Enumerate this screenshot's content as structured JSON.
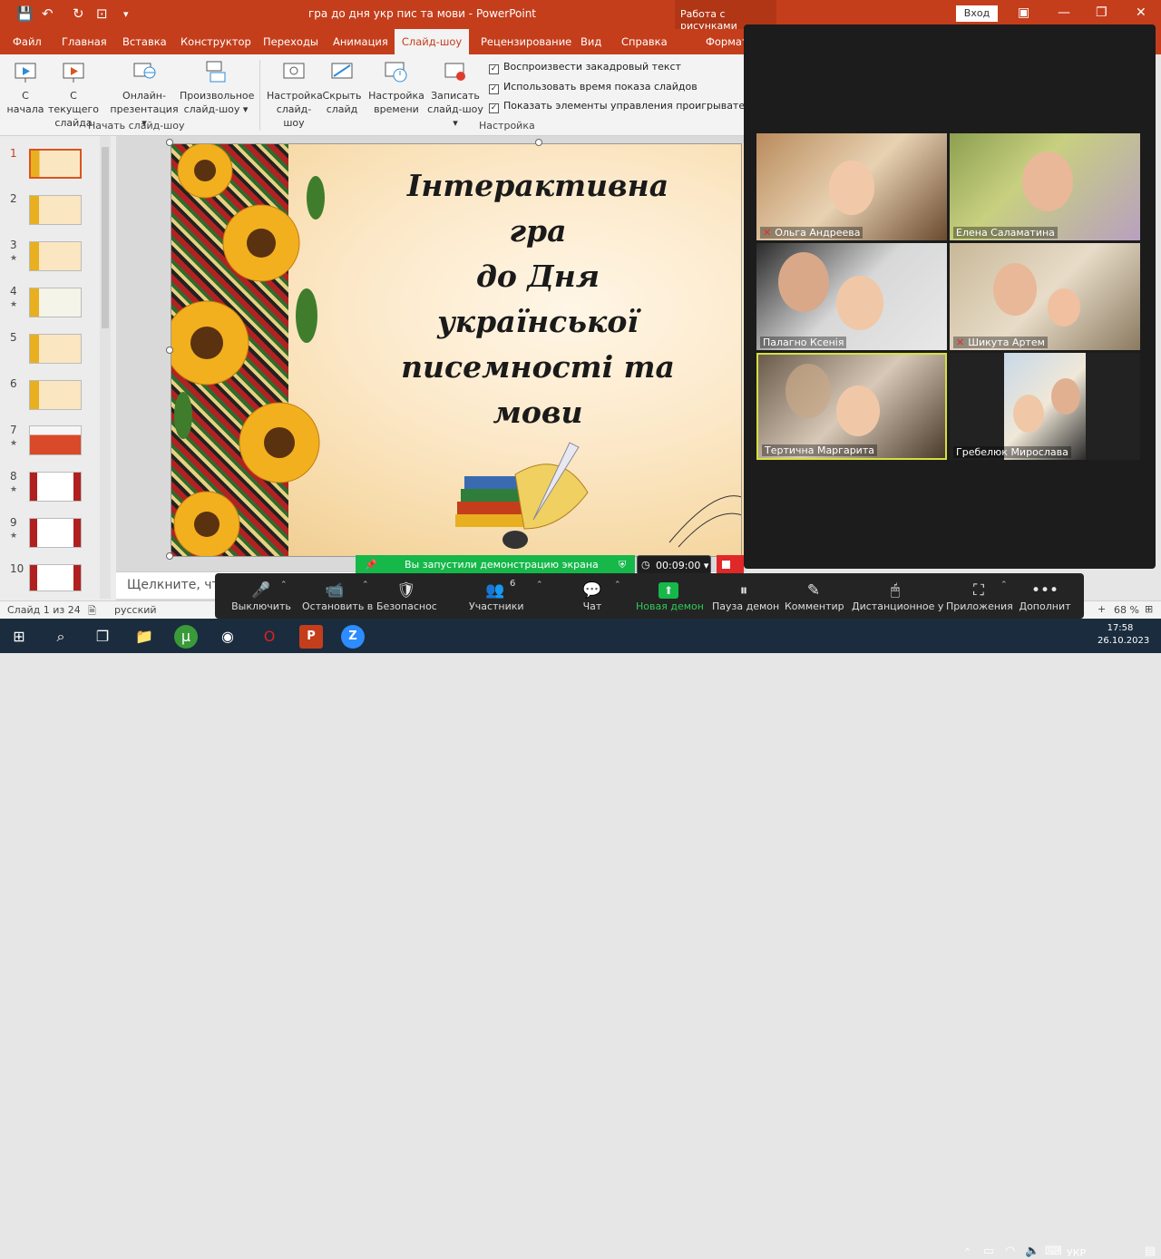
{
  "window": {
    "title": "гра до дня укр пис та мови  -  PowerPoint",
    "context_title": "Работа с рисунками",
    "login_label": "Вход"
  },
  "tabs": [
    "Файл",
    "Главная",
    "Вставка",
    "Конструктор",
    "Переходы",
    "Анимация",
    "Слайд-шоу",
    "Рецензирование",
    "Вид",
    "Справка",
    "Формат"
  ],
  "active_tab": "Слайд-шоу",
  "ribbon": {
    "buttons": [
      {
        "line1": "С",
        "line2": "начала"
      },
      {
        "line1": "С текущего",
        "line2": "слайда"
      },
      {
        "line1": "Онлайн-",
        "line2": "презентация ▾"
      },
      {
        "line1": "Произвольное",
        "line2": "слайд-шоу ▾"
      },
      {
        "line1": "Настройка",
        "line2": "слайд-шоу"
      },
      {
        "line1": "Скрыть",
        "line2": "слайд"
      },
      {
        "line1": "Настройка",
        "line2": "времени"
      },
      {
        "line1": "Записать",
        "line2": "слайд-шоу ▾"
      }
    ],
    "group_start": "Начать слайд-шоу",
    "group_setup": "Настройка",
    "checkboxes": [
      {
        "label": "Воспроизвести закадровый текст",
        "checked": true
      },
      {
        "label": "Использовать время показа слайдов",
        "checked": true
      },
      {
        "label": "Показать элементы управления проигрывателем",
        "checked": true
      }
    ]
  },
  "thumbnails": [
    {
      "num": "1",
      "star": ""
    },
    {
      "num": "2",
      "star": ""
    },
    {
      "num": "3",
      "star": "★"
    },
    {
      "num": "4",
      "star": "★"
    },
    {
      "num": "5",
      "star": ""
    },
    {
      "num": "6",
      "star": ""
    },
    {
      "num": "7",
      "star": "★"
    },
    {
      "num": "8",
      "star": "★"
    },
    {
      "num": "9",
      "star": "★"
    },
    {
      "num": "10",
      "star": ""
    }
  ],
  "slide": {
    "lines": [
      "Інтерактивна",
      "гра",
      "до Дня",
      "української",
      "писемності та",
      "мови"
    ]
  },
  "notes_placeholder": "Щелкните, чтоб",
  "status": {
    "slide_info": "Слайд 1 из 24",
    "language": "русский",
    "zoom": "68 %"
  },
  "participants": [
    {
      "name": "Ольга Андреева",
      "muted": true
    },
    {
      "name": "Елена Саламатина",
      "muted": false
    },
    {
      "name": "Палагно Ксенія",
      "muted": false
    },
    {
      "name": "Шикута Артем",
      "muted": true
    },
    {
      "name": "Тертична Маргарита",
      "muted": false
    },
    {
      "name": "Гребелюк Мирослава",
      "muted": false
    }
  ],
  "share": {
    "banner": "Вы запустили демонстрацию экрана",
    "timer": "00:09:00 ▾"
  },
  "zoom_toolbar": {
    "items": [
      {
        "icon": "🎤",
        "label": "Выключить"
      },
      {
        "icon": "📹",
        "label": "Остановить в"
      },
      {
        "icon": "🛡",
        "label": "Безопаснос"
      },
      {
        "icon": "👥",
        "label": "Участники",
        "badge": "6"
      },
      {
        "icon": "💬",
        "label": "Чат"
      },
      {
        "icon": "⬆",
        "label": "Новая демон"
      },
      {
        "icon": "⏸",
        "label": "Пауза демон"
      },
      {
        "icon": "✎",
        "label": "Комментир"
      },
      {
        "icon": "🖱",
        "label": "Дистанционное у"
      },
      {
        "icon": "⛶",
        "label": "Приложения"
      },
      {
        "icon": "•••",
        "label": "Дополнит"
      }
    ]
  },
  "taskbar": {
    "lang": "УКР",
    "time": "17:58",
    "date": "26.10.2023"
  },
  "colors": {
    "powerpoint_red": "#c43e1c",
    "zoom_green": "#16b84a",
    "zoom_dark": "#1c1c1c"
  }
}
